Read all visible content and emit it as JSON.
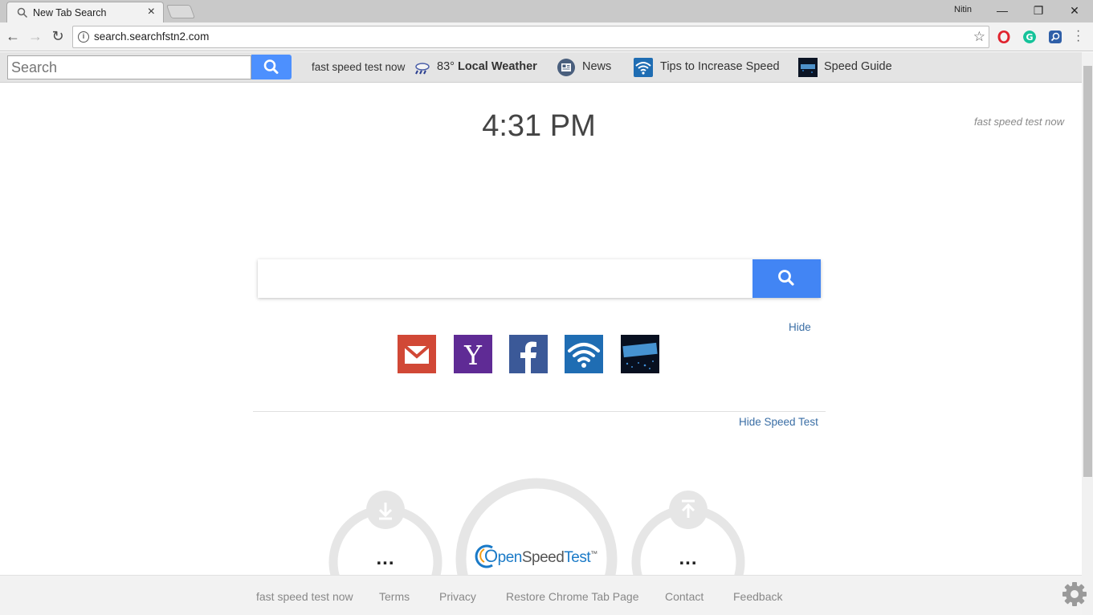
{
  "browser": {
    "tab_title": "New Tab Search",
    "tab_close": "×",
    "profile_name": "Nitin",
    "url": "search.searchfstn2.com",
    "window_controls": {
      "minimize": "—",
      "restore": "❐",
      "close": "✕"
    },
    "nav": {
      "back": "←",
      "forward": "→",
      "reload": "↻",
      "bookmark": "☆"
    }
  },
  "extension_bar": {
    "search_placeholder": "Search",
    "links": [
      {
        "label": "fast speed test now"
      },
      {
        "label": "83° ",
        "bold": "Local Weather"
      },
      {
        "label": "News"
      },
      {
        "label": "Tips to Increase Speed"
      },
      {
        "label": "Speed Guide"
      }
    ]
  },
  "main": {
    "clock": "4:31 PM",
    "corner_link": "fast speed test now",
    "search_placeholder": "",
    "hide_link": "Hide",
    "tiles": [
      "gmail-icon",
      "yahoo-icon",
      "facebook-icon",
      "wifi-icon",
      "speed-icon"
    ],
    "hide_speed_test": "Hide Speed Test",
    "speed_test": {
      "download_value": "...",
      "upload_value": "...",
      "logo_text_1": "pen",
      "logo_text_2": "Speed",
      "logo_text_3": "Test",
      "logo_tm": "™"
    }
  },
  "footer": {
    "links": [
      "fast speed test now",
      "Terms",
      "Privacy",
      "Restore Chrome Tab Page",
      "Contact",
      "Feedback"
    ]
  },
  "colors": {
    "accent_blue": "#4285f4",
    "link_blue": "#3a6ea5",
    "gmail_red": "#d14836",
    "yahoo_purple": "#5f2b95",
    "facebook_blue": "#3b5998",
    "wifi_blue": "#1f6db3"
  }
}
